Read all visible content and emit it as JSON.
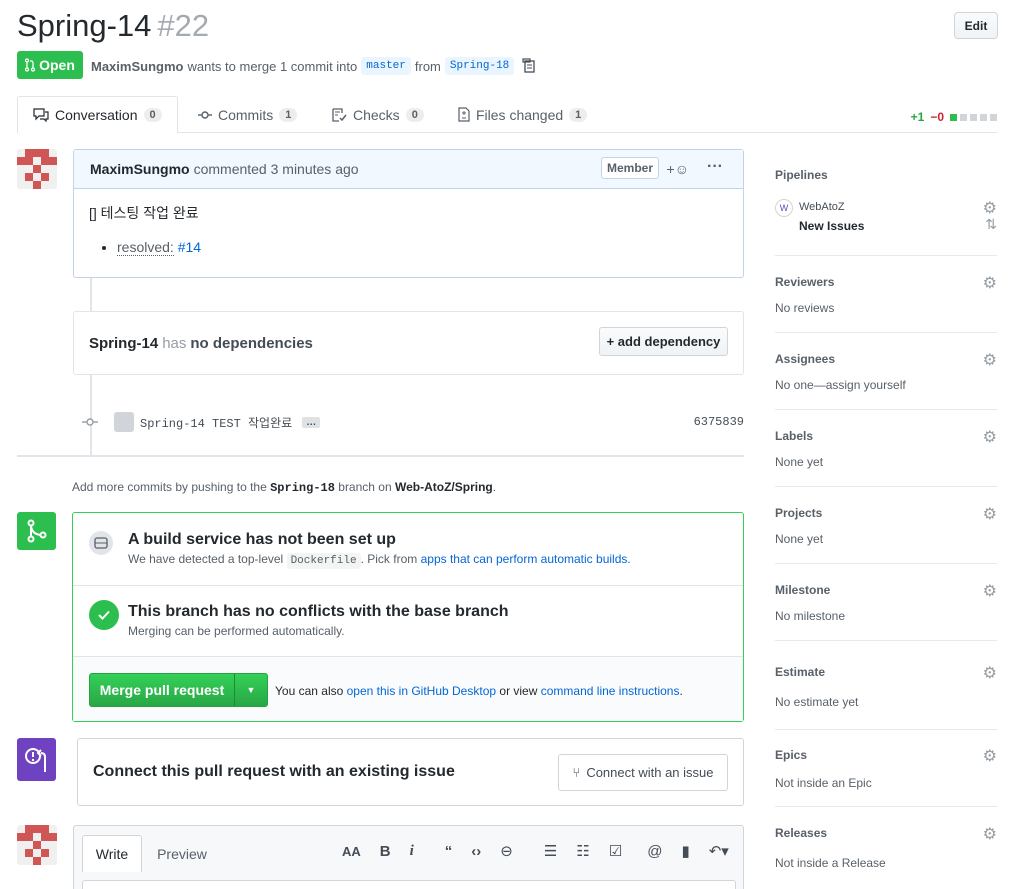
{
  "pr": {
    "title": "Spring-14",
    "number": "#22",
    "edit_label": "Edit",
    "state": "Open",
    "author": "MaximSungmo",
    "meta_text": "wants to merge 1 commit into",
    "base_branch": "master",
    "from_text": "from",
    "head_branch": "Spring-18"
  },
  "tabs": [
    {
      "label": "Conversation",
      "count": "0"
    },
    {
      "label": "Commits",
      "count": "1"
    },
    {
      "label": "Checks",
      "count": "0"
    },
    {
      "label": "Files changed",
      "count": "1"
    }
  ],
  "diffstat": {
    "additions": "+1",
    "deletions": "−0"
  },
  "comment": {
    "author": "MaximSungmo",
    "action": "commented 3 minutes ago",
    "badge": "Member",
    "body_line": "[] 테스팅 작업 완료",
    "list_label": "resolved:",
    "list_link": "#14"
  },
  "dependency": {
    "name": "Spring-14",
    "has": "has",
    "status": "no dependencies",
    "button": "+ add dependency"
  },
  "commit": {
    "message": "Spring-14 TEST 작업완료",
    "ellipsis": "…",
    "sha": "6375839"
  },
  "hint": {
    "prefix": "Add more commits by pushing to the",
    "branch": "Spring-18",
    "middle": "branch on",
    "repo": "Web-AtoZ/Spring",
    "suffix": "."
  },
  "build": {
    "title": "A build service has not been set up",
    "sub_prefix": "We have detected a top-level",
    "file": "Dockerfile",
    "sub_middle": ". Pick from",
    "link": "apps that can perform automatic builds."
  },
  "conflicts": {
    "title": "This branch has no conflicts with the base branch",
    "sub": "Merging can be performed automatically."
  },
  "merge": {
    "button": "Merge pull request",
    "also_prefix": "You can also",
    "desktop_link": "open this in GitHub Desktop",
    "or_text": "or view",
    "cli_link": "command line instructions",
    "suffix": "."
  },
  "connect": {
    "title": "Connect this pull request with an existing issue",
    "button": "Connect with an issue"
  },
  "editor": {
    "write": "Write",
    "preview": "Preview"
  },
  "sidebar": {
    "pipelines": {
      "title": "Pipelines",
      "workspace": "WebAtoZ",
      "pipeline": "New Issues",
      "badge": "W"
    },
    "reviewers": {
      "title": "Reviewers",
      "value": "No reviews"
    },
    "assignees": {
      "title": "Assignees",
      "value": "No one—assign yourself"
    },
    "labels": {
      "title": "Labels",
      "value": "None yet"
    },
    "projects": {
      "title": "Projects",
      "value": "None yet"
    },
    "milestone": {
      "title": "Milestone",
      "value": "No milestone"
    },
    "estimate": {
      "title": "Estimate",
      "value": "No estimate yet"
    },
    "epics": {
      "title": "Epics",
      "value": "Not inside an Epic"
    },
    "releases": {
      "title": "Releases",
      "value": "Not inside a Release"
    }
  },
  "colors": {
    "green": "#2cbe4e",
    "purple": "#6f42c1",
    "link": "#0366d6"
  }
}
